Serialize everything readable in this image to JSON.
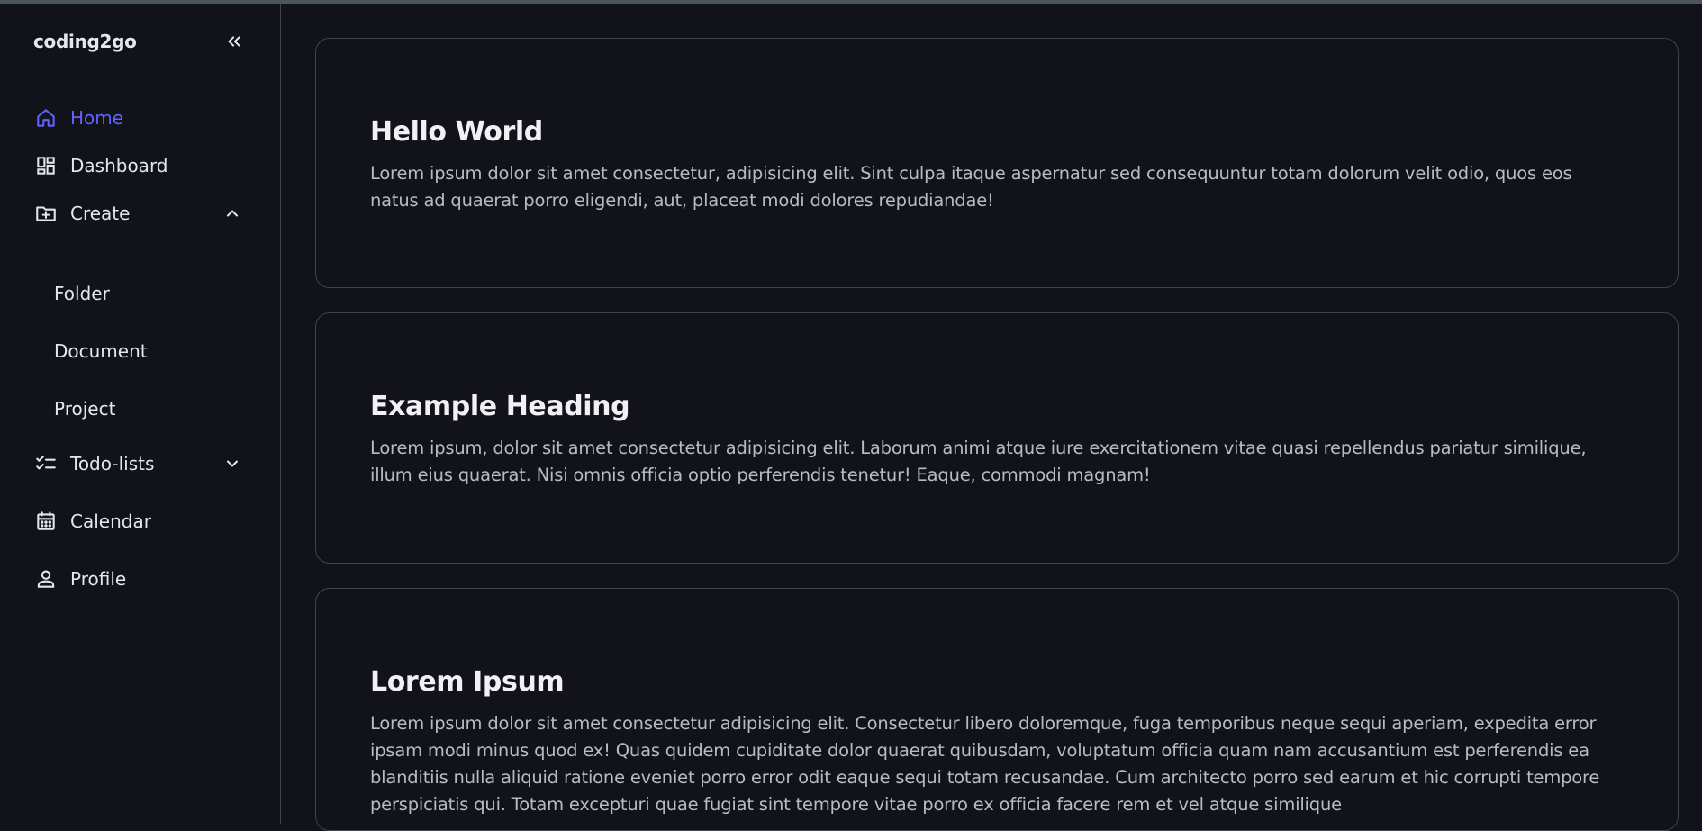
{
  "brand": {
    "logo": "coding2go"
  },
  "sidebar": {
    "collapse_icon": "double-chevron-left-icon",
    "items": [
      {
        "label": "Home",
        "icon": "home-icon",
        "active": true
      },
      {
        "label": "Dashboard",
        "icon": "dashboard-icon"
      },
      {
        "label": "Create",
        "icon": "folder-plus-icon",
        "expanded": true,
        "subitems": [
          "Folder",
          "Document",
          "Project"
        ]
      },
      {
        "label": "Todo-lists",
        "icon": "checklist-icon",
        "expanded": false
      },
      {
        "label": "Calendar",
        "icon": "calendar-icon"
      },
      {
        "label": "Profile",
        "icon": "person-icon"
      }
    ]
  },
  "main": {
    "cards": [
      {
        "heading": "Hello World",
        "body": "Lorem ipsum dolor sit amet consectetur, adipisicing elit. Sint culpa itaque aspernatur sed consequuntur totam dolorum velit odio, quos eos natus ad quaerat porro eligendi, aut, placeat modi dolores repudiandae!"
      },
      {
        "heading": "Example Heading",
        "body": "Lorem ipsum, dolor sit amet consectetur adipisicing elit. Laborum animi atque iure exercitationem vitae quasi repellendus pariatur similique, illum eius quaerat. Nisi omnis officia optio perferendis tenetur! Eaque, commodi magnam!"
      },
      {
        "heading": "Lorem Ipsum",
        "body": "Lorem ipsum dolor sit amet consectetur adipisicing elit. Consectetur libero doloremque, fuga temporibus neque sequi aperiam, expedita error ipsam modi minus quod ex! Quas quidem cupiditate dolor quaerat quibusdam, voluptatum officia quam nam accusantium est perferendis ea blanditiis nulla aliquid ratione eveniet porro error odit eaque sequi totam recusandae. Cum architecto porro sed earum et hic corrupti tempore perspiciatis qui. Totam excepturi quae fugiat sint tempore vitae porro ex officia facere rem et vel atque similique"
      }
    ]
  },
  "colors": {
    "background": "#11121a",
    "border": "#42434a",
    "accent": "#5e63ff",
    "text": "#e6e6ef",
    "muted": "#b9bac6"
  }
}
